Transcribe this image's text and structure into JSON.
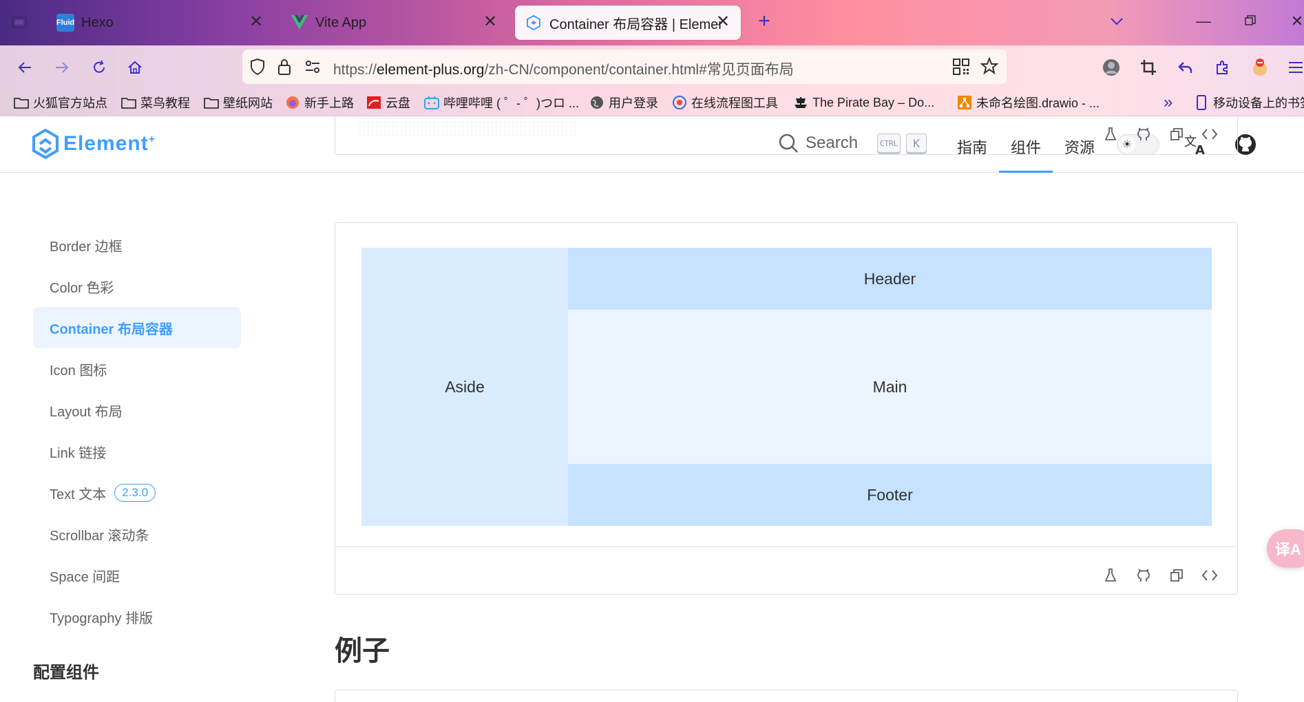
{
  "browser": {
    "tabs": [
      {
        "title": "Hexo",
        "icon": "fluid-icon",
        "close": "✕"
      },
      {
        "title": "Vite App",
        "icon": "vue-icon",
        "close": "✕"
      },
      {
        "title": "Container 布局容器 | Element",
        "icon": "element-icon",
        "close": "✕"
      }
    ],
    "new_tab": "+",
    "url": {
      "prefix": "https://",
      "host": "element-plus.org",
      "path": "/zh-CN/component/container.html#常见页面布局"
    },
    "bookmarks": [
      {
        "label": "火狐官方站点",
        "icon": "folder-icon"
      },
      {
        "label": "菜鸟教程",
        "icon": "folder-icon"
      },
      {
        "label": "壁纸网站",
        "icon": "folder-icon"
      },
      {
        "label": "新手上路",
        "icon": "firefox-icon"
      },
      {
        "label": "云盘",
        "icon": "cloud-disk-icon"
      },
      {
        "label": "哔哩哔哩 ( ゜- ゜)つロ ...",
        "icon": "bilibili-icon"
      },
      {
        "label": "用户登录",
        "icon": "globe-icon"
      },
      {
        "label": "在线流程图工具",
        "icon": "flowchart-icon"
      },
      {
        "label": "The Pirate Bay – Do...",
        "icon": "pirate-ship-icon"
      },
      {
        "label": "未命名绘图.drawio - ...",
        "icon": "drawio-icon"
      },
      {
        "label": "移动设备上的书签",
        "icon": "mobile-icon"
      }
    ],
    "accent_colors": {
      "gradient_left": "#4a2a83",
      "gradient_mid": "#e06aa0",
      "gradient_right": "#c27ad6"
    }
  },
  "site": {
    "logo_text": "Element",
    "logo_sup": "+",
    "search_label": "Search",
    "search_shortcut": [
      "CTRL",
      "K"
    ],
    "nav": [
      "指南",
      "组件",
      "资源"
    ],
    "active_nav": "组件"
  },
  "sidebar": {
    "items": [
      {
        "label": "Border 边框"
      },
      {
        "label": "Color 色彩"
      },
      {
        "label": "Container 布局容器"
      },
      {
        "label": "Icon 图标"
      },
      {
        "label": "Layout 布局"
      },
      {
        "label": "Link 链接"
      },
      {
        "label": "Text 文本",
        "badge": "2.3.0"
      },
      {
        "label": "Scrollbar 滚动条"
      },
      {
        "label": "Space 间距"
      },
      {
        "label": "Typography 排版"
      }
    ],
    "active_item": "Container 布局容器",
    "section_heading": "配置组件"
  },
  "demo": {
    "aside": "Aside",
    "header": "Header",
    "main": "Main",
    "footer": "Footer",
    "colors": {
      "aside": "#d9ecff",
      "header": "#c6e2ff",
      "main": "#ecf5ff",
      "footer": "#c6e2ff"
    }
  },
  "section_title": "例子",
  "floating_button": "译A"
}
